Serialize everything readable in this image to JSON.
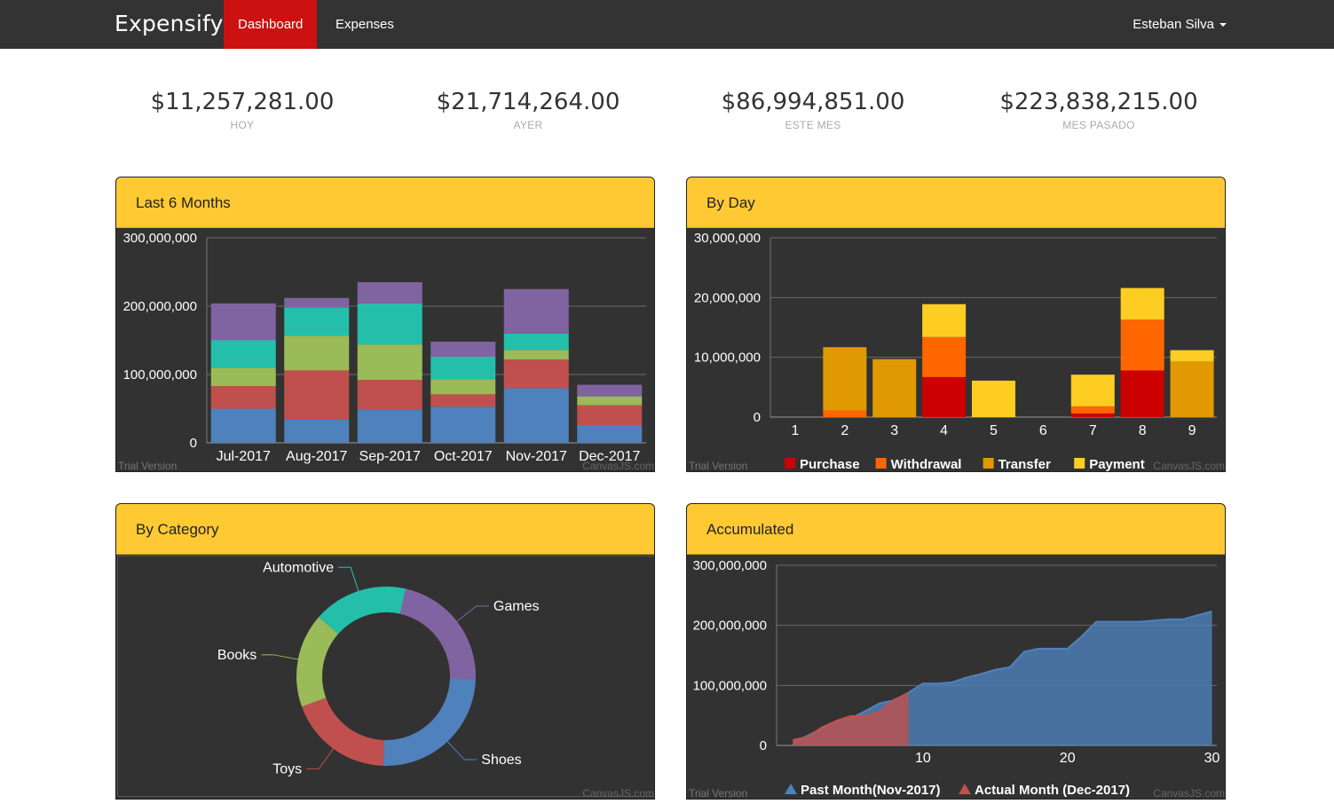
{
  "nav": {
    "brand": "Expensify",
    "items": [
      "Dashboard",
      "Expenses"
    ],
    "user": "Esteban Silva"
  },
  "stats": [
    {
      "value": "$11,257,281.00",
      "label": "HOY"
    },
    {
      "value": "$21,714,264.00",
      "label": "AYER"
    },
    {
      "value": "$86,994,851.00",
      "label": "ESTE MES"
    },
    {
      "value": "$223,838,215.00",
      "label": "MES PASADO"
    }
  ],
  "panels": {
    "months": "Last 6 Months",
    "byday": "By Day",
    "category": "By Category",
    "accumulated": "Accumulated"
  },
  "watermarks": {
    "trial": "Trial Version",
    "canvasjs": "CanvasJS.com"
  },
  "colors": {
    "nav": "#333333",
    "active": "#cc1111",
    "panel_header": "#fec933",
    "chart_bg": "#323232"
  },
  "chart_data": [
    {
      "id": "months",
      "type": "bar",
      "stacked": true,
      "categories": [
        "Jul-2017",
        "Aug-2017",
        "Sep-2017",
        "Oct-2017",
        "Nov-2017",
        "Dec-2017"
      ],
      "ylim": [
        0,
        300000000
      ],
      "yticks": [
        0,
        100000000,
        200000000,
        300000000
      ],
      "ytick_labels": [
        "0",
        "100,000,000",
        "200,000,000",
        "300,000,000"
      ],
      "grid": true,
      "series": [
        {
          "color": "#4f81bc",
          "values": [
            50000000,
            34000000,
            49000000,
            53000000,
            80000000,
            26000000
          ]
        },
        {
          "color": "#c0504e",
          "values": [
            33000000,
            72000000,
            43000000,
            18000000,
            42000000,
            29000000
          ]
        },
        {
          "color": "#9bbb58",
          "values": [
            27000000,
            51000000,
            52000000,
            22000000,
            14000000,
            13000000
          ]
        },
        {
          "color": "#23bfaa",
          "values": [
            40000000,
            41000000,
            60000000,
            33000000,
            24000000,
            0
          ]
        },
        {
          "color": "#8064a1",
          "values": [
            54000000,
            14000000,
            31000000,
            22000000,
            65000000,
            17000000
          ]
        }
      ]
    },
    {
      "id": "byday",
      "type": "bar",
      "stacked": true,
      "categories": [
        "1",
        "2",
        "3",
        "4",
        "5",
        "6",
        "7",
        "8",
        "9"
      ],
      "ylim": [
        0,
        30000000
      ],
      "yticks": [
        0,
        10000000,
        20000000,
        30000000
      ],
      "ytick_labels": [
        "0",
        "10,000,000",
        "20,000,000",
        "30,000,000"
      ],
      "grid": true,
      "legend": "bottom",
      "series": [
        {
          "name": "Purchase",
          "color": "#cc0000",
          "values": [
            0,
            0,
            0,
            6700000,
            0,
            0,
            600000,
            7800000,
            0
          ]
        },
        {
          "name": "Withdrawal",
          "color": "#ff6600",
          "values": [
            0,
            1100000,
            0,
            6700000,
            0,
            0,
            1200000,
            8500000,
            0
          ]
        },
        {
          "name": "Transfer",
          "color": "#e09900",
          "values": [
            0,
            10600000,
            9700000,
            0,
            0,
            0,
            0,
            0,
            9300000
          ]
        },
        {
          "name": "Payment",
          "color": "#fecd22",
          "values": [
            0,
            0,
            0,
            5500000,
            6100000,
            0,
            5300000,
            5300000,
            1900000
          ]
        }
      ]
    },
    {
      "id": "category",
      "type": "pie",
      "donut": true,
      "labels": [
        "Games",
        "Shoes",
        "Toys",
        "Books",
        "Automotive"
      ],
      "values": [
        22,
        25,
        19,
        17,
        17
      ],
      "colors": [
        "#8064a1",
        "#4f81bc",
        "#c0504e",
        "#9bbb58",
        "#23bfaa"
      ]
    },
    {
      "id": "accumulated",
      "type": "area",
      "xlim": [
        0,
        30
      ],
      "ylim": [
        0,
        300000000
      ],
      "xticks": [
        10,
        20,
        30
      ],
      "yticks": [
        0,
        100000000,
        200000000,
        300000000
      ],
      "ytick_labels": [
        "0",
        "100,000,000",
        "200,000,000",
        "300,000,000"
      ],
      "grid": true,
      "legend": "bottom",
      "series": [
        {
          "name": "Past Month(Nov-2017)",
          "color": "#4f81bc",
          "x": [
            1,
            2,
            3,
            4,
            5,
            6,
            7,
            8,
            9,
            10,
            11,
            12,
            13,
            14,
            15,
            16,
            17,
            18,
            19,
            20,
            21,
            22,
            23,
            24,
            25,
            26,
            27,
            28,
            29,
            30
          ],
          "y": [
            5000000,
            16000000,
            28000000,
            40000000,
            45000000,
            57000000,
            70000000,
            75000000,
            88000000,
            103000000,
            103000000,
            105000000,
            113000000,
            119000000,
            126000000,
            130000000,
            156000000,
            161000000,
            161000000,
            161000000,
            182000000,
            206000000,
            206000000,
            206000000,
            206000000,
            208000000,
            210000000,
            210000000,
            217000000,
            223000000
          ]
        },
        {
          "name": "Actual Month (Dec-2017)",
          "color": "#c0504e",
          "x": [
            1,
            2,
            3,
            4,
            5,
            6,
            7,
            8,
            9
          ],
          "y": [
            9000000,
            14000000,
            30000000,
            41000000,
            49000000,
            49000000,
            56000000,
            76000000,
            87000000
          ]
        }
      ]
    }
  ]
}
